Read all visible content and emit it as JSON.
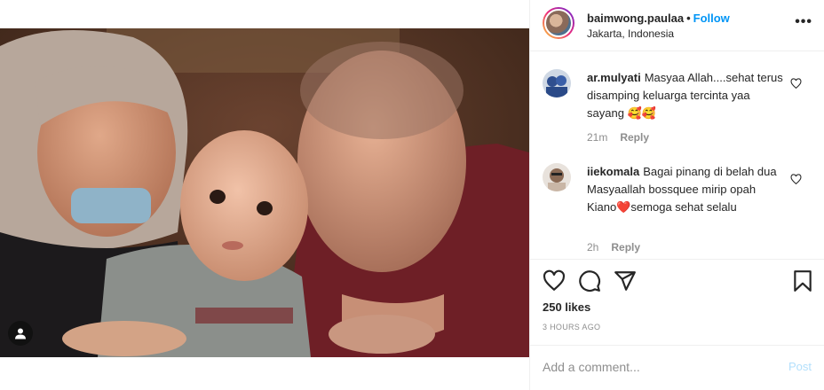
{
  "post": {
    "username": "baimwong.paulaa",
    "separator": "•",
    "follow_label": "Follow",
    "location": "Jakarta, Indonesia",
    "more_label": "•••"
  },
  "comments": [
    {
      "username": "ar.mulyati",
      "text": "Masyaa Allah....sehat terus disamping keluarga tercinta yaa sayang 🥰🥰",
      "time": "21m",
      "reply_label": "Reply"
    },
    {
      "username": "iiekomala",
      "text": "Bagai pinang di belah dua Masyaallah bossquee mirip opah Kiano❤️semoga sehat selalu",
      "time": "2h",
      "reply_label": "Reply"
    }
  ],
  "likes_label": "250 likes",
  "timestamp": "3 HOURS AGO",
  "add_comment": {
    "placeholder": "Add a comment...",
    "post_label": "Post"
  },
  "icons": [
    "heart-icon",
    "comment-icon",
    "share-icon",
    "bookmark-icon",
    "user-tag-icon",
    "more-icon"
  ],
  "colors": {
    "accent": "#0095f6",
    "post_disabled": "#b2dffc",
    "muted": "#8e8e8e"
  }
}
